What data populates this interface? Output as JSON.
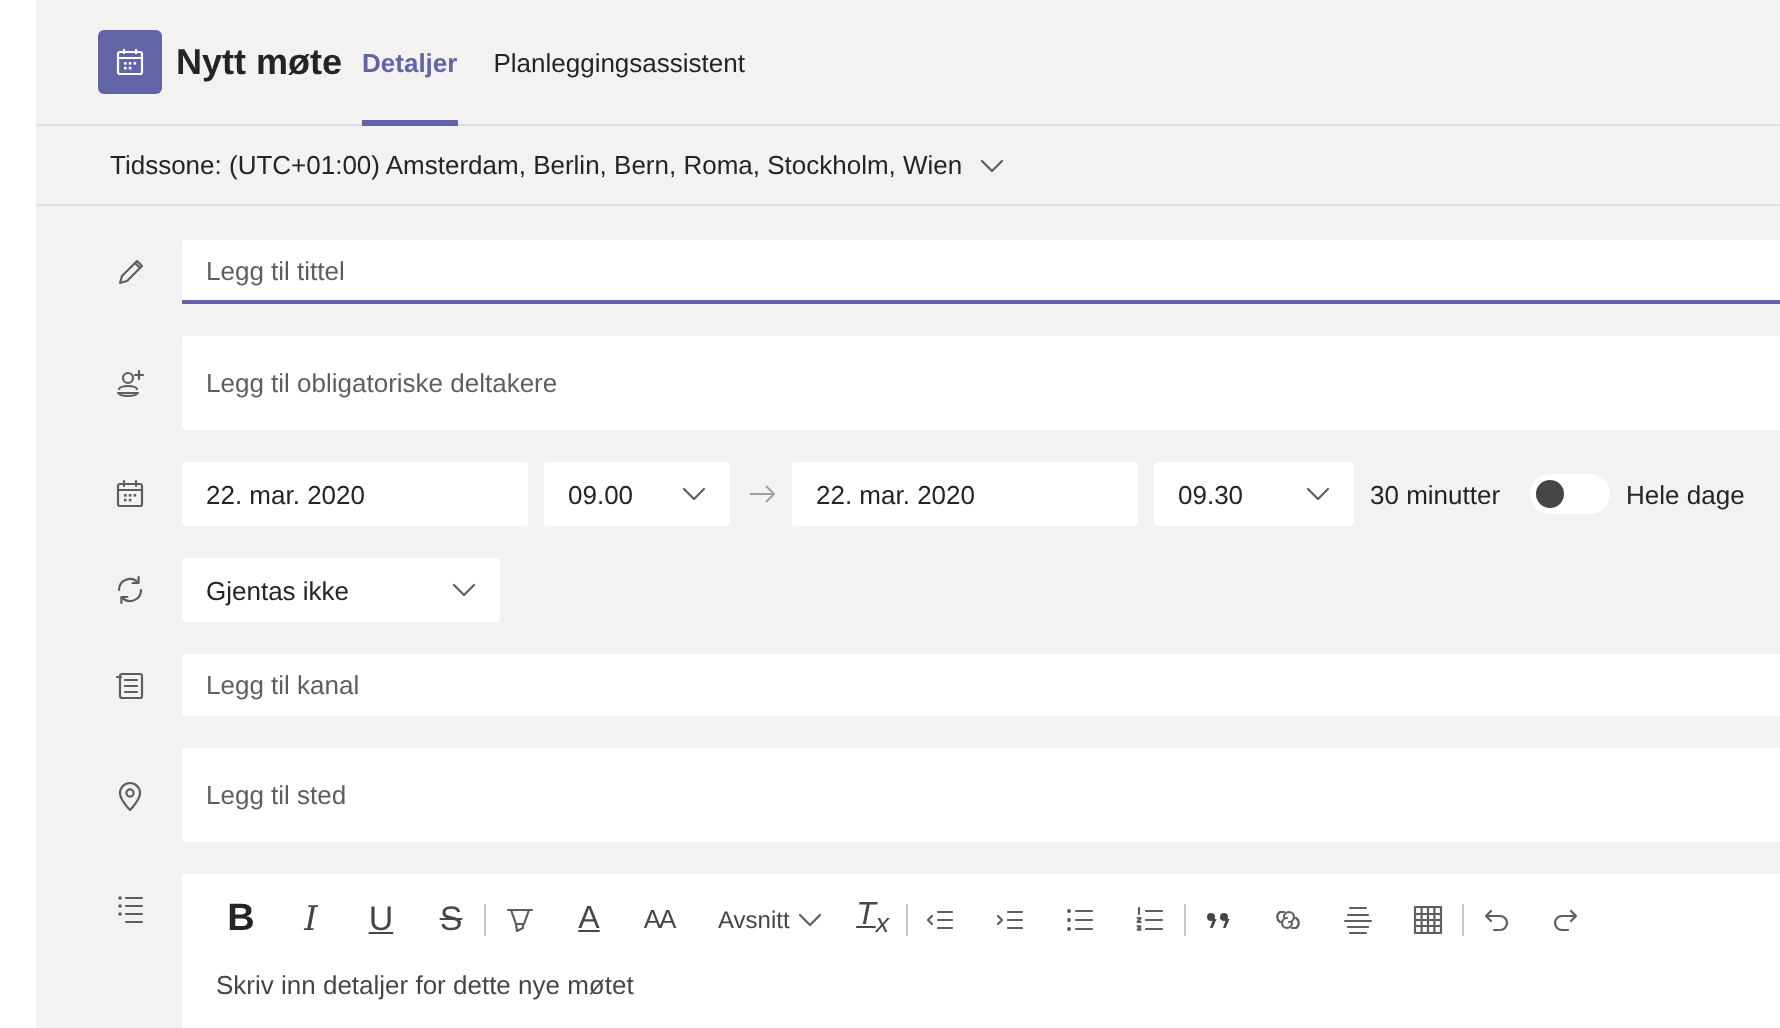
{
  "header": {
    "title": "Nytt møte",
    "tabs": [
      {
        "label": "Detaljer",
        "selected": true
      },
      {
        "label": "Planleggingsassistent",
        "selected": false
      }
    ]
  },
  "timezone": {
    "label": "Tidssone: (UTC+01:00) Amsterdam, Berlin, Bern, Roma, Stockholm, Wien"
  },
  "title_field": {
    "placeholder": "Legg til tittel",
    "focused": true
  },
  "attendees_field": {
    "placeholder": "Legg til obligatoriske deltakere"
  },
  "schedule": {
    "start_date": "22. mar. 2020",
    "start_time": "09.00",
    "end_date": "22. mar. 2020",
    "end_time": "09.30",
    "duration": "30 minutter",
    "all_day": {
      "label": "Hele dage",
      "on": false
    }
  },
  "repeat": {
    "value": "Gjentas ikke"
  },
  "channel_field": {
    "placeholder": "Legg til kanal"
  },
  "location_field": {
    "placeholder": "Legg til sted"
  },
  "editor": {
    "toolbar": [
      {
        "kind": "bold",
        "text": "B"
      },
      {
        "kind": "italic",
        "text": "I"
      },
      {
        "kind": "underline",
        "text": "U"
      },
      {
        "kind": "strike",
        "text": "S"
      },
      {
        "kind": "separator"
      },
      {
        "kind": "highlight"
      },
      {
        "kind": "font_color",
        "text": "A"
      },
      {
        "kind": "font_size",
        "text": "AA"
      },
      {
        "kind": "dropdown",
        "text": "Avsnitt"
      },
      {
        "kind": "clear_format",
        "text": "T$_{x}$"
      },
      {
        "kind": "separator"
      },
      {
        "kind": "outdent"
      },
      {
        "kind": "indent"
      },
      {
        "kind": "bullets"
      },
      {
        "kind": "numbered"
      },
      {
        "kind": "separator"
      },
      {
        "kind": "quote"
      },
      {
        "kind": "link"
      },
      {
        "kind": "rule"
      },
      {
        "kind": "table"
      },
      {
        "kind": "separator"
      },
      {
        "kind": "undo"
      },
      {
        "kind": "redo"
      }
    ],
    "placeholder": "Skriv inn detaljer for dette nye møtet"
  }
}
